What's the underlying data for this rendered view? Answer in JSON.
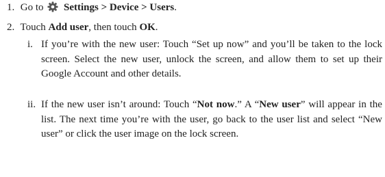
{
  "steps": [
    {
      "number": "1.",
      "pre": "Go to",
      "icon": "settings-gear-icon",
      "bold": "Settings > Device > Users",
      "post": "."
    },
    {
      "number": "2.",
      "pre": "Touch",
      "bold1": "Add user",
      "mid": ", then touch",
      "bold2": "OK",
      "post": "."
    }
  ],
  "substeps": [
    {
      "number": "i.",
      "text": "If you’re with the new user: Touch “Set up now” and you’ll be taken to the lock screen. Select the new user, unlock the screen, and allow them to set up their Google Account and other details."
    },
    {
      "number": "ii.",
      "pre": "If the new user isn’t around: Touch “",
      "bold1": "Not now",
      "mid1": ".” A “",
      "bold2": "New user",
      "post": "” will appear in the list. The next time you’re with the user, go back to the user list and select “New user” or click the user image on the lock screen."
    }
  ],
  "colors": {
    "text": "#222222",
    "icon": "#555555"
  }
}
